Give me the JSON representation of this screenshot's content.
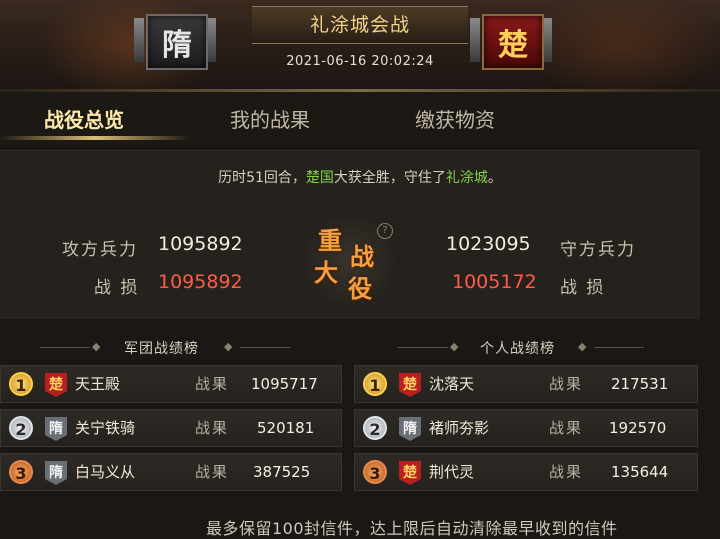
{
  "header": {
    "attacker_faction": "隋",
    "defender_faction": "楚",
    "battle_title": "礼涂城会战",
    "battle_time": "2021-06-16  20:02:24"
  },
  "tabs": [
    {
      "label": "战役总览",
      "active": true
    },
    {
      "label": "我的战果",
      "active": false
    },
    {
      "label": "缴获物资",
      "active": false
    }
  ],
  "summary": {
    "sentence_prefix": "历时51回合，",
    "winner": "楚国",
    "sentence_mid": "大获全胜，守住了",
    "city": "礼涂城",
    "sentence_end": "。",
    "attacker": {
      "troops_label": "攻方兵力",
      "troops": "1095892",
      "loss_label": "战 损",
      "loss": "1095892"
    },
    "defender": {
      "troops_label": "守方兵力",
      "troops": "1023095",
      "loss_label": "战 损",
      "loss": "1005172"
    },
    "emblem_chars": [
      "重",
      "战",
      "大",
      "役"
    ],
    "help_icon": "?"
  },
  "legion_rank": {
    "title": "军团战绩榜",
    "score_label": "战果",
    "rows": [
      {
        "rank": "1",
        "faction": "楚",
        "name": "天王殿",
        "score": "1095717"
      },
      {
        "rank": "2",
        "faction": "隋",
        "name": "关宁铁骑",
        "score": "520181"
      },
      {
        "rank": "3",
        "faction": "隋",
        "name": "白马义从",
        "score": "387525"
      }
    ]
  },
  "personal_rank": {
    "title": "个人战绩榜",
    "score_label": "战果",
    "rows": [
      {
        "rank": "1",
        "faction": "楚",
        "name": "沈落天",
        "score": "217531"
      },
      {
        "rank": "2",
        "faction": "隋",
        "name": "褚师夯影",
        "score": "192570"
      },
      {
        "rank": "3",
        "faction": "楚",
        "name": "荆代灵",
        "score": "135644"
      }
    ]
  },
  "footer_note": "最多保留100封信件，达上限后自动清除最早收到的信件",
  "colors": {
    "win_green": "#7fd14a",
    "loss_red": "#ff5a4a",
    "tab_active": "#ffe9a8",
    "chu_red": "#b82020",
    "sui_gray": "#6a6e76"
  }
}
